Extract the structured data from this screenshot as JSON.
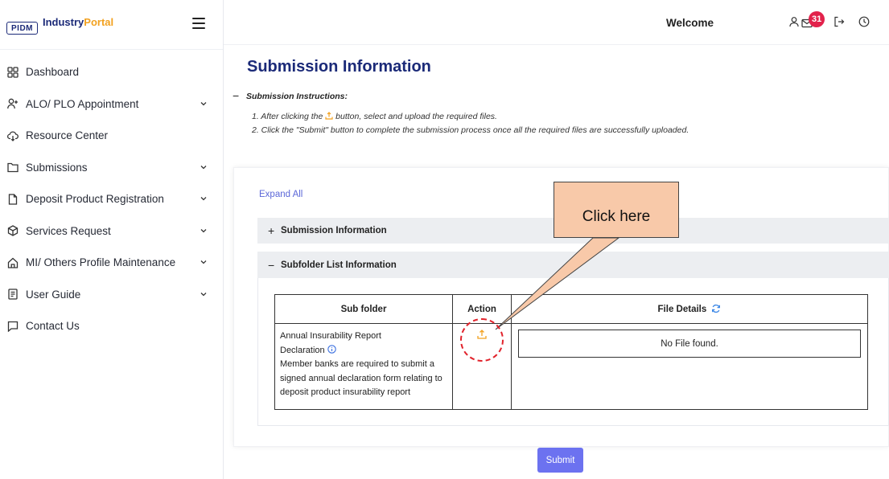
{
  "brand": {
    "logo_box": "PIDM",
    "name_part1": "Industry",
    "name_part2": "Portal"
  },
  "sidebar": {
    "items": [
      {
        "label": "Dashboard",
        "icon": "grid-icon",
        "has_chevron": false
      },
      {
        "label": "ALO/ PLO Appointment",
        "icon": "user-plus-icon",
        "has_chevron": true
      },
      {
        "label": "Resource Center",
        "icon": "cloud-icon",
        "has_chevron": false
      },
      {
        "label": "Submissions",
        "icon": "folder-icon",
        "has_chevron": true
      },
      {
        "label": "Deposit Product Registration",
        "icon": "document-icon",
        "has_chevron": true
      },
      {
        "label": "Services Request",
        "icon": "cube-icon",
        "has_chevron": true
      },
      {
        "label": "MI/ Others Profile Maintenance",
        "icon": "home-icon",
        "has_chevron": true
      },
      {
        "label": "User Guide",
        "icon": "book-icon",
        "has_chevron": true
      },
      {
        "label": "Contact Us",
        "icon": "chat-icon",
        "has_chevron": false
      }
    ]
  },
  "topbar": {
    "welcome": "Welcome",
    "mail_count": "31"
  },
  "main": {
    "title": "Submission Information",
    "instructions": {
      "toggle": "−",
      "title": "Submission Instructions:",
      "line1_before": "1. After clicking the",
      "line1_after": "button, select and upload the required files.",
      "line2": "2. Click the \"Submit\" button to complete the submission process once all the required files are successfully uploaded."
    },
    "expand_all": "Expand All",
    "accordion": [
      {
        "sign": "+",
        "label": "Submission Information"
      },
      {
        "sign": "−",
        "label": "Subfolder List Information"
      }
    ],
    "table": {
      "headers": {
        "subfolder": "Sub folder",
        "action": "Action",
        "file_details": "File Details"
      },
      "row": {
        "name_line1": "Annual Insurability Report",
        "name_line2": "Declaration",
        "description": "Member banks are required to submit a signed annual declaration form relating to deposit product insurability report",
        "file_status": "No File found."
      }
    },
    "submit_label": "Submit"
  },
  "annotation": {
    "label": "Click here"
  },
  "colors": {
    "brand": "#1b2a78",
    "accent": "#f2a11f",
    "badge": "#e2224b",
    "submit": "#6c72f0",
    "callout": "#f8c9a9",
    "highlight": "#e1222b"
  }
}
